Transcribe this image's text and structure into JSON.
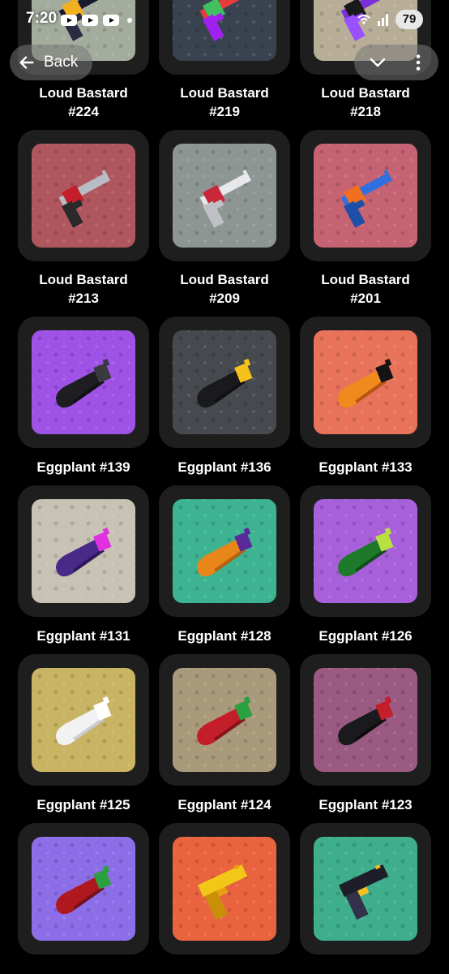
{
  "status_bar": {
    "time": "7:20",
    "battery": "79"
  },
  "nav": {
    "back_label": "Back"
  },
  "items": [
    {
      "name": "Loud Bastard",
      "number": "#224",
      "bg": "#a4ad9d",
      "item": "revolver",
      "palette": [
        "#1a1a2e",
        "#f0b020",
        "#2b2b44"
      ]
    },
    {
      "name": "Loud Bastard",
      "number": "#219",
      "bg": "#394350",
      "item": "revolver",
      "palette": [
        "#e63c3c",
        "#40c060",
        "#a020f0"
      ]
    },
    {
      "name": "Loud Bastard",
      "number": "#218",
      "bg": "#b8ae98",
      "item": "revolver",
      "palette": [
        "#7a30d8",
        "#1a1a1a",
        "#9a50ff"
      ]
    },
    {
      "name": "Loud Bastard",
      "number": "#213",
      "bg": "#b0565e",
      "item": "revolver",
      "palette": [
        "#b8bcc4",
        "#c41e2a",
        "#2a2a2a"
      ]
    },
    {
      "name": "Loud Bastard",
      "number": "#209",
      "bg": "#8d9692",
      "item": "revolver",
      "palette": [
        "#e8e8ec",
        "#c8283a",
        "#bfbfc6"
      ]
    },
    {
      "name": "Loud Bastard",
      "number": "#201",
      "bg": "#c56372",
      "item": "revolver",
      "palette": [
        "#2f6fe0",
        "#f07020",
        "#1d4fa8"
      ]
    },
    {
      "name": "Eggplant",
      "number": "#139",
      "bg": "#9e53e6",
      "item": "eggplant",
      "palette": [
        "#1e1e22",
        "#3a3a40",
        "#101012"
      ]
    },
    {
      "name": "Eggplant",
      "number": "#136",
      "bg": "#46494e",
      "item": "eggplant",
      "palette": [
        "#1a1a1c",
        "#f4c21a",
        "#101012"
      ]
    },
    {
      "name": "Eggplant",
      "number": "#133",
      "bg": "#e8735a",
      "item": "eggplant",
      "palette": [
        "#f08a1e",
        "#141414",
        "#b0500e"
      ]
    },
    {
      "name": "Eggplant",
      "number": "#131",
      "bg": "#c7c2b3",
      "item": "eggplant",
      "palette": [
        "#4a2a88",
        "#e030e0",
        "#2a1458"
      ]
    },
    {
      "name": "Eggplant",
      "number": "#128",
      "bg": "#3db391",
      "item": "eggplant",
      "palette": [
        "#e8861a",
        "#5a2a9a",
        "#b05e0e"
      ]
    },
    {
      "name": "Eggplant",
      "number": "#126",
      "bg": "#a860da",
      "item": "eggplant",
      "palette": [
        "#1e7a2a",
        "#b8e040",
        "#0e4a16"
      ]
    },
    {
      "name": "Eggplant",
      "number": "#125",
      "bg": "#c8b463",
      "item": "eggplant",
      "palette": [
        "#f2f2f2",
        "#ffffff",
        "#c8c8d0"
      ]
    },
    {
      "name": "Eggplant",
      "number": "#124",
      "bg": "#aa9a7c",
      "item": "eggplant",
      "palette": [
        "#c41e2a",
        "#2aa040",
        "#80101a"
      ]
    },
    {
      "name": "Eggplant",
      "number": "#123",
      "bg": "#9a5a82",
      "item": "eggplant",
      "palette": [
        "#1a1a1c",
        "#c41e2a",
        "#0c0c0e"
      ]
    },
    {
      "name": "",
      "number": "",
      "bg": "#8c6ee8",
      "item": "eggplant",
      "palette": [
        "#b01820",
        "#2aa040",
        "#70101a"
      ]
    },
    {
      "name": "",
      "number": "",
      "bg": "#e9643e",
      "item": "pistol",
      "palette": [
        "#f2c818",
        "#e8a010",
        "#c89008"
      ]
    },
    {
      "name": "",
      "number": "",
      "bg": "#3fae8c",
      "item": "pistol",
      "palette": [
        "#1e1e2a",
        "#f0c020",
        "#32324a"
      ]
    }
  ]
}
